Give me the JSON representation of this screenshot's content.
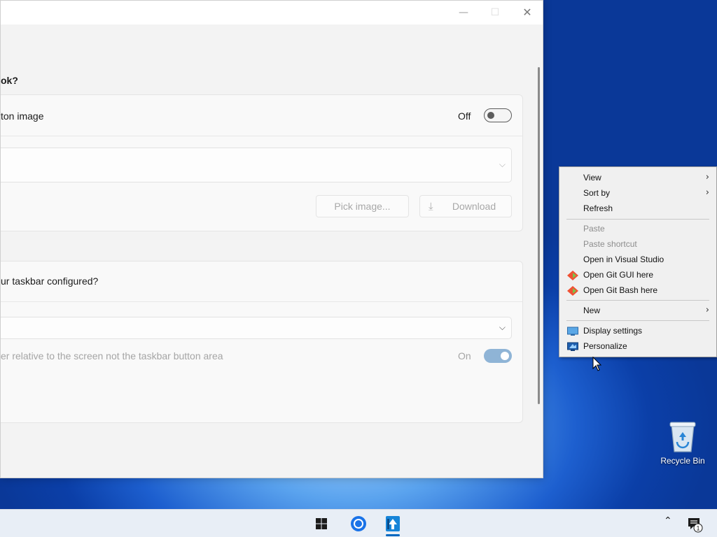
{
  "window": {
    "caption_min": "—",
    "caption_max": "☐",
    "caption_close": "✕",
    "section1_heading": "ok?",
    "toggle_row_label": "ton image",
    "toggle_row_state": "Off",
    "pick_image_label": "Pick image...",
    "download_label": "Download",
    "download_icon": "download-icon",
    "section2_question": "ur taskbar configured?",
    "relative_row_label": "er relative to the screen not the taskbar button area",
    "relative_row_state": "On",
    "combo_chevron": "⌵"
  },
  "context_menu": {
    "items": [
      {
        "label": "View",
        "submenu": true,
        "enabled": true
      },
      {
        "label": "Sort by",
        "submenu": true,
        "enabled": true
      },
      {
        "label": "Refresh",
        "submenu": false,
        "enabled": true
      },
      {
        "label": "Paste",
        "submenu": false,
        "enabled": false
      },
      {
        "label": "Paste shortcut",
        "submenu": false,
        "enabled": false
      },
      {
        "label": "Open in Visual Studio",
        "submenu": false,
        "enabled": true
      },
      {
        "label": "Open Git GUI here",
        "submenu": false,
        "enabled": true,
        "icon": "git-icon"
      },
      {
        "label": "Open Git Bash here",
        "submenu": false,
        "enabled": true,
        "icon": "git-icon"
      },
      {
        "label": "New",
        "submenu": true,
        "enabled": true
      },
      {
        "label": "Display settings",
        "submenu": false,
        "enabled": true,
        "icon": "display-icon"
      },
      {
        "label": "Personalize",
        "submenu": false,
        "enabled": true,
        "icon": "personalize-icon"
      }
    ],
    "submenu_arrow": "›"
  },
  "desktop": {
    "recycle_bin_label": "Recycle Bin"
  },
  "taskbar": {
    "apps": [
      "start-icon",
      "chrome-icon",
      "app-icon"
    ],
    "tray_chevron": "⌃",
    "notification_count": "1"
  },
  "colors": {
    "accent": "#0067c0",
    "git_orange": "#f05133",
    "git_green": "#7cc24a"
  }
}
